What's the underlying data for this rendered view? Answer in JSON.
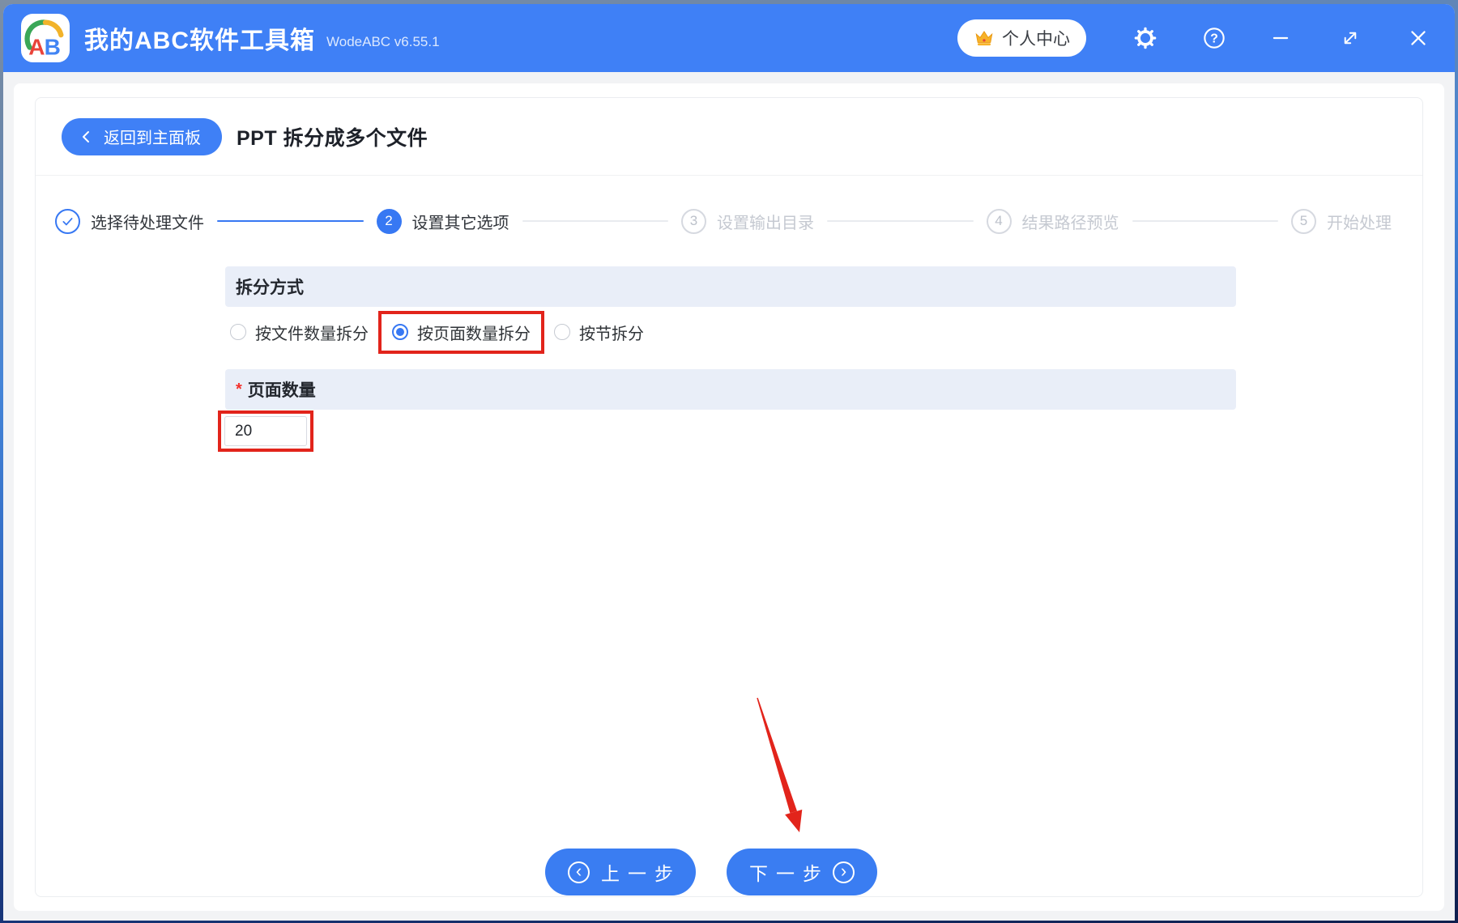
{
  "titlebar": {
    "logo_letters": "AB",
    "app_title": "我的ABC软件工具箱",
    "version": "WodeABC v6.55.1",
    "user_center_label": "个人中心"
  },
  "header": {
    "back_button": "返回到主面板",
    "page_title": "PPT 拆分成多个文件"
  },
  "stepper": {
    "steps": [
      {
        "num": "1",
        "label": "选择待处理文件",
        "state": "done"
      },
      {
        "num": "2",
        "label": "设置其它选项",
        "state": "active"
      },
      {
        "num": "3",
        "label": "设置输出目录",
        "state": "pending"
      },
      {
        "num": "4",
        "label": "结果路径预览",
        "state": "pending"
      },
      {
        "num": "5",
        "label": "开始处理",
        "state": "pending"
      }
    ]
  },
  "form": {
    "split_mode": {
      "title": "拆分方式",
      "options": [
        {
          "label": "按文件数量拆分",
          "selected": false
        },
        {
          "label": "按页面数量拆分",
          "selected": true,
          "annotated": true
        },
        {
          "label": "按节拆分",
          "selected": false
        }
      ]
    },
    "page_count": {
      "title": "页面数量",
      "required_mark": "*",
      "value": "20"
    }
  },
  "footer": {
    "prev_button": "上一步",
    "next_button": "下一步"
  },
  "colors": {
    "titlebar_blue": "#3f80f6",
    "accent_blue": "#3778f3",
    "band_bg": "#e9eef8",
    "inactive_gray": "#c5c9d1",
    "annotation_red": "#e2241b"
  }
}
